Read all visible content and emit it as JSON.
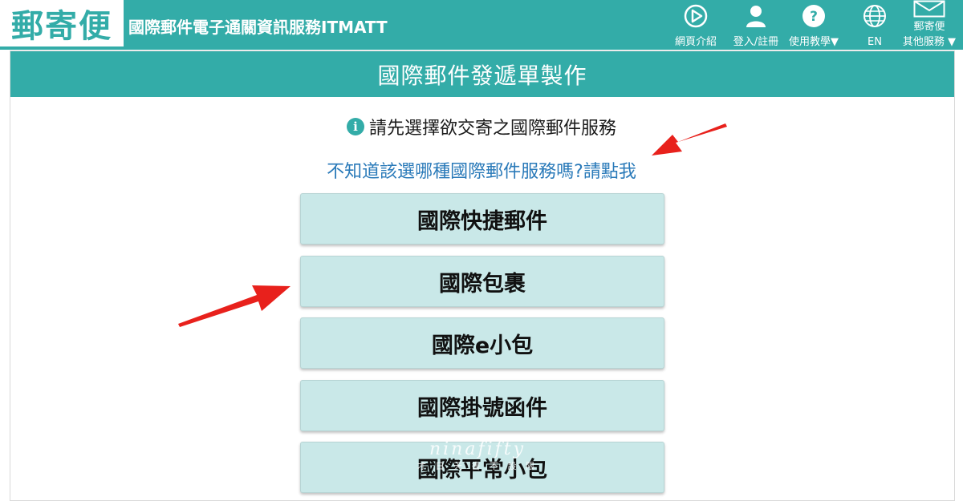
{
  "header": {
    "logo": "郵寄便",
    "site_title": "國際郵件電子通關資訊服務ITMATT",
    "nav": [
      {
        "label": "網頁介紹",
        "icon": "play-circle-icon"
      },
      {
        "label": "登入/註冊",
        "icon": "user-icon"
      },
      {
        "label": "使用教學▼",
        "icon": "question-icon"
      },
      {
        "label": "EN",
        "icon": "globe-icon"
      },
      {
        "label": "郵寄便",
        "sub": "其他服務 ▼",
        "icon": "mail-icon"
      }
    ]
  },
  "page": {
    "heading": "國際郵件發遞單製作",
    "instruction": "請先選擇欲交寄之國際郵件服務",
    "help_link": "不知道該選哪種國際郵件服務嗎?請點我"
  },
  "services": [
    "國際快捷郵件",
    "國際包裹",
    "國際e小包",
    "國際掛號函件",
    "國際平常小包"
  ],
  "watermark": {
    "line1": "ninafifty",
    "line2": "才 日 天 書 不 設 限"
  },
  "colors": {
    "primary": "#33aca8",
    "button_bg": "#c9e8e8",
    "link": "#2a7ab9",
    "arrow": "#e8211c"
  }
}
